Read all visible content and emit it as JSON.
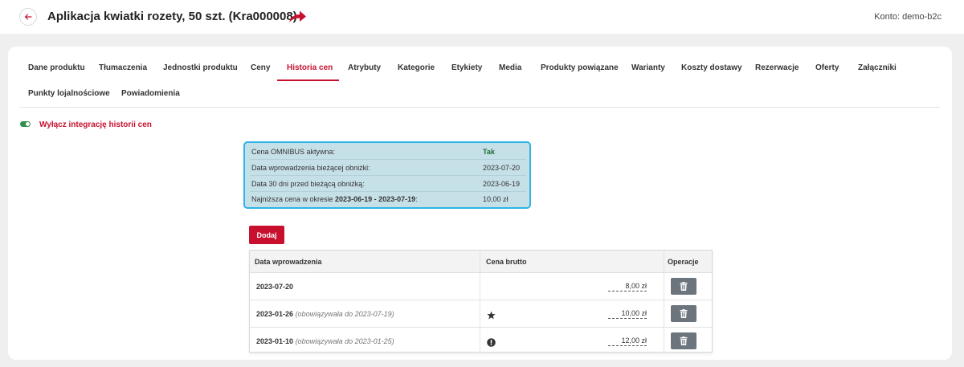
{
  "header": {
    "title": "Aplikacja kwiatki rozety, 50 szt. (Kra000008)",
    "account": "Konto: demo-b2c"
  },
  "tabs": [
    {
      "label": "Dane produktu"
    },
    {
      "label": "Tłumaczenia"
    },
    {
      "label": "Jednostki produktu"
    },
    {
      "label": "Ceny"
    },
    {
      "label": "Historia cen",
      "active": true
    },
    {
      "label": "Atrybuty"
    },
    {
      "label": "Kategorie"
    },
    {
      "label": "Etykiety"
    },
    {
      "label": "Media"
    },
    {
      "label": "Produkty powiązane"
    },
    {
      "label": "Warianty"
    },
    {
      "label": "Koszty dostawy"
    },
    {
      "label": "Rezerwacje"
    },
    {
      "label": "Oferty"
    },
    {
      "label": "Załączniki"
    },
    {
      "label": "Punkty lojalnościowe"
    },
    {
      "label": "Powiadomienia"
    }
  ],
  "integration": {
    "toggle_label": "Wyłącz integrację historii cen",
    "enabled": true
  },
  "omnibus": {
    "active_label": "Cena OMNIBUS aktywna:",
    "active_value": "Tak",
    "discount_date_label": "Data wprowadzenia bieżącej obniżki:",
    "discount_date_value": "2023-07-20",
    "before_date_label": "Data 30 dni przed bieżącą obniżką:",
    "before_date_value": "2023-06-19",
    "lowest_label_prefix": "Najniższa cena w okresie ",
    "lowest_period": "2023-06-19 - 2023-07-19",
    "lowest_label_suffix": ":",
    "lowest_value": "10,00 zł"
  },
  "add_button": "Dodaj",
  "table": {
    "col_date": "Data wprowadzenia",
    "col_price": "Cena brutto",
    "col_ops": "Operacje",
    "rows": [
      {
        "date": "2023-07-20",
        "note": "",
        "icon": "",
        "price": "8,00 zł"
      },
      {
        "date": "2023-01-26",
        "note": "(obowiązywała do 2023-07-19)",
        "icon": "star-icon",
        "price": "10,00 zł"
      },
      {
        "date": "2023-01-10",
        "note": "(obowiązywała do 2023-01-25)",
        "icon": "exclamation-icon",
        "price": "12,00 zł"
      }
    ]
  },
  "colors": {
    "accent": "#c8102e",
    "toggle_on": "#2f8f4e",
    "omnibus_bg": "#c6e0e8",
    "omnibus_border": "#2eb4e6",
    "delete_button": "#6c757d"
  }
}
